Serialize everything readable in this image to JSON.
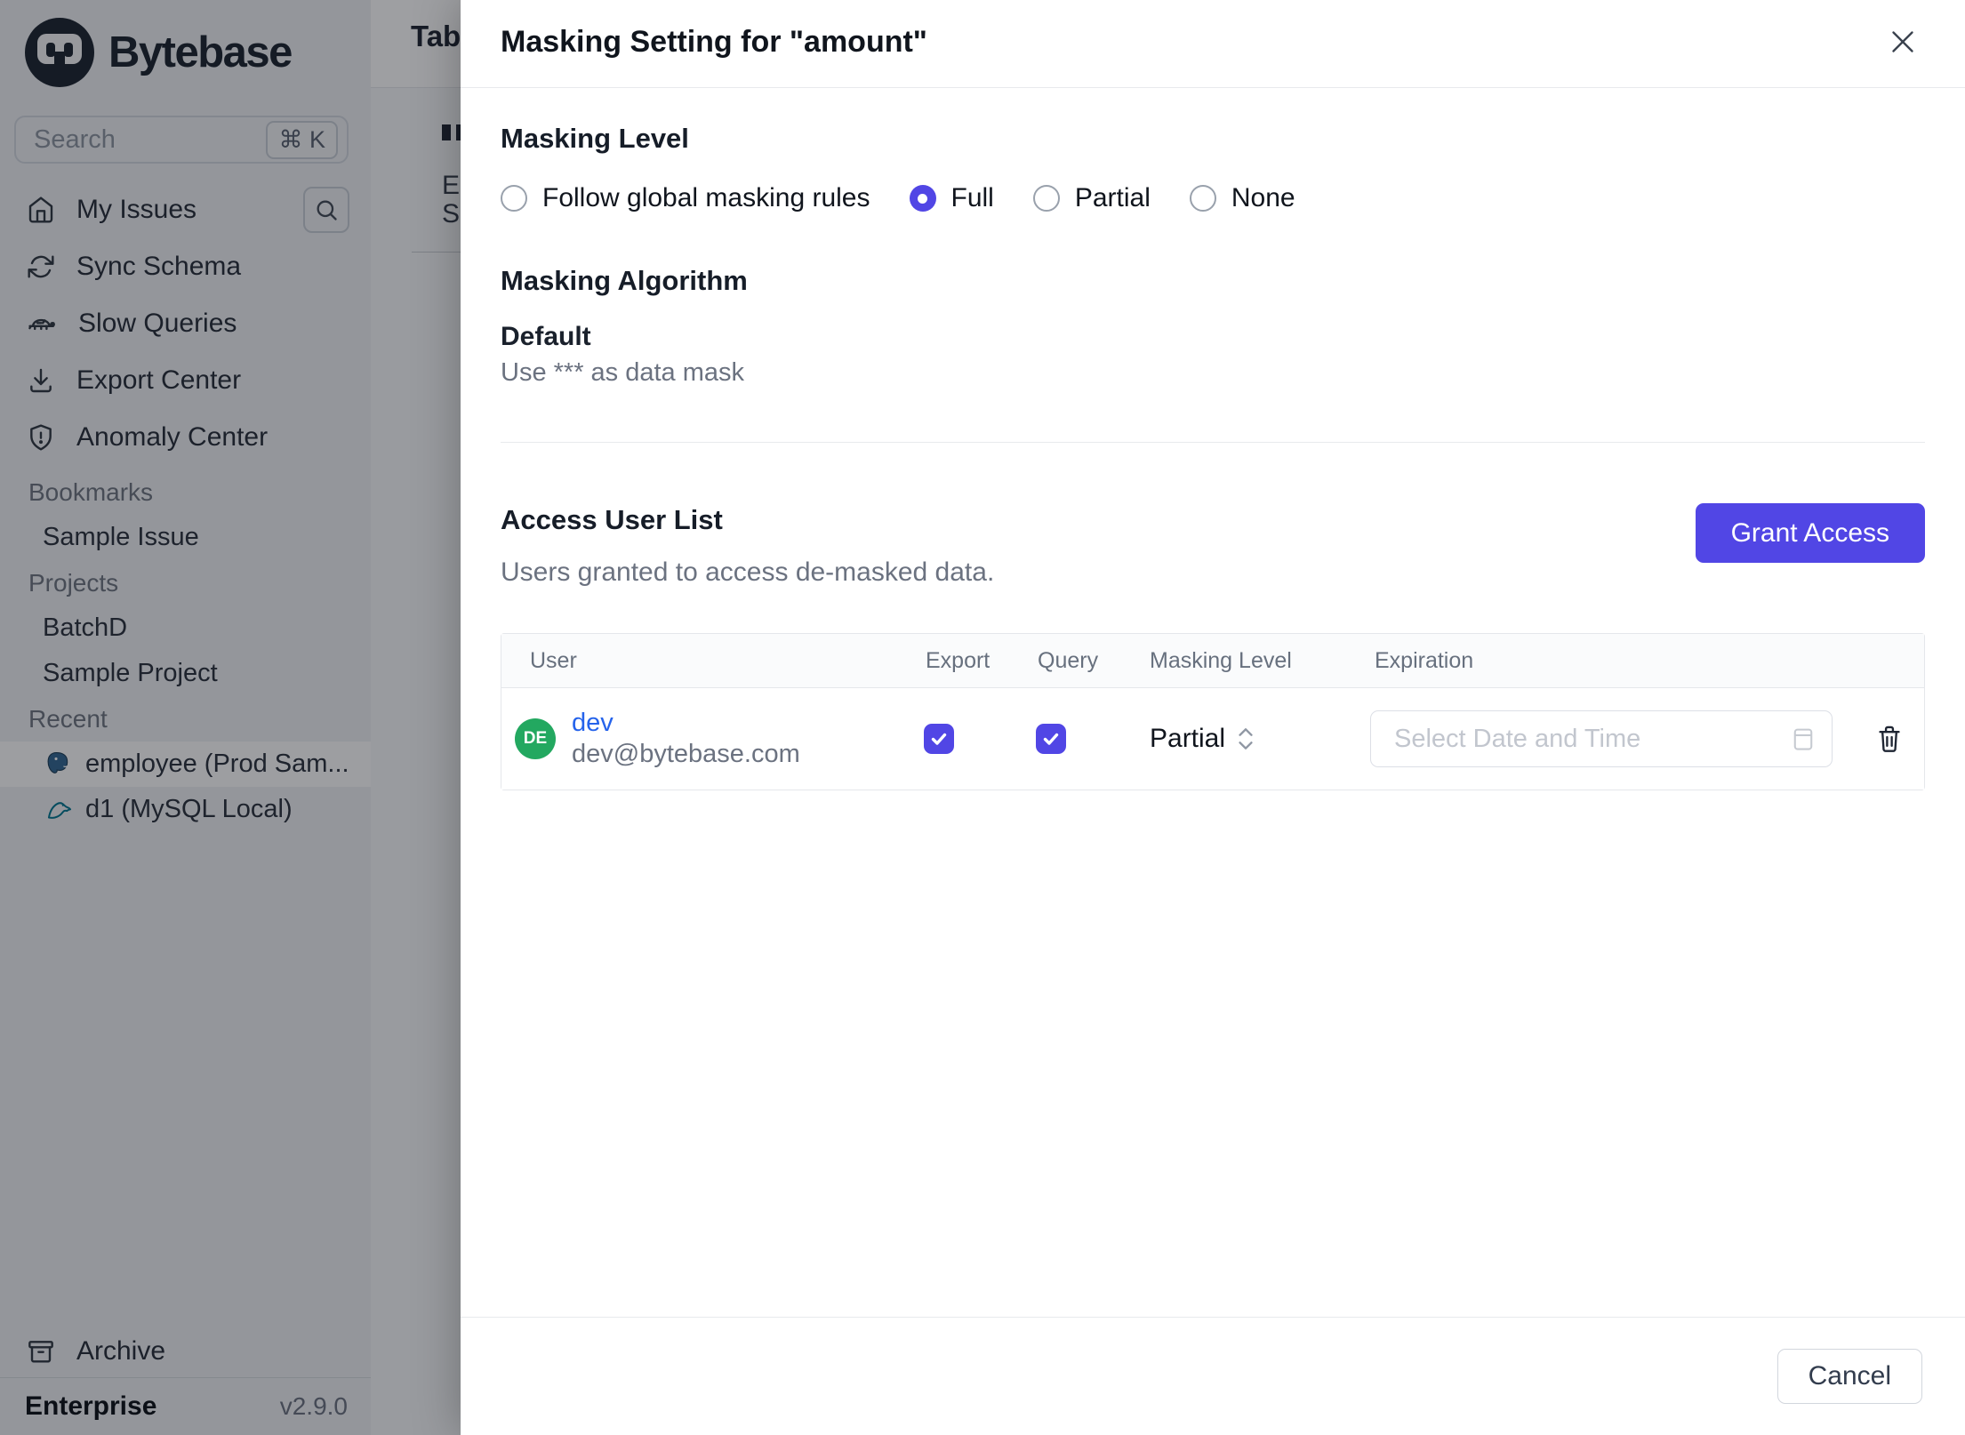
{
  "sidebar": {
    "logo_text": "Bytebase",
    "search": {
      "placeholder": "Search",
      "kbd": "⌘ K"
    },
    "nav": [
      {
        "label": "My Issues"
      },
      {
        "label": "Sync Schema"
      },
      {
        "label": "Slow Queries"
      },
      {
        "label": "Export Center"
      },
      {
        "label": "Anomaly Center"
      }
    ],
    "sections": {
      "bookmarks_title": "Bookmarks",
      "bookmarks_item": "Sample Issue",
      "projects_title": "Projects",
      "project_1": "BatchD",
      "project_2": "Sample Project",
      "recent_title": "Recent",
      "recent_1": "employee (Prod Sam...",
      "recent_2": "d1 (MySQL Local)"
    },
    "archive_label": "Archive",
    "footer": {
      "plan": "Enterprise",
      "version": "v2.9.0"
    }
  },
  "page_behind": {
    "tab_title_fragment": "Tab",
    "fragment_line_1": "E",
    "fragment_line_2": "S"
  },
  "modal": {
    "title": "Masking Setting for \"amount\"",
    "masking_level": {
      "heading": "Masking Level",
      "options": [
        {
          "label": "Follow global masking rules",
          "selected": false
        },
        {
          "label": "Full",
          "selected": true
        },
        {
          "label": "Partial",
          "selected": false
        },
        {
          "label": "None",
          "selected": false
        }
      ]
    },
    "masking_algorithm": {
      "heading": "Masking Algorithm",
      "name": "Default",
      "description": "Use *** as data mask"
    },
    "access_user_list": {
      "heading": "Access User List",
      "subtitle": "Users granted to access de-masked data.",
      "grant_button": "Grant Access",
      "table": {
        "columns": [
          "User",
          "Export",
          "Query",
          "Masking Level",
          "Expiration"
        ],
        "rows": [
          {
            "avatar_initials": "DE",
            "name": "dev",
            "email": "dev@bytebase.com",
            "export_checked": true,
            "query_checked": true,
            "masking_level": "Partial",
            "expiration_placeholder": "Select Date and Time"
          }
        ]
      }
    },
    "cancel_label": "Cancel"
  },
  "colors": {
    "accent": "#5146e5",
    "link_blue": "#2563eb",
    "avatar_green": "#23a860",
    "postgres_blue": "#336791",
    "mysql_teal": "#00758f"
  }
}
